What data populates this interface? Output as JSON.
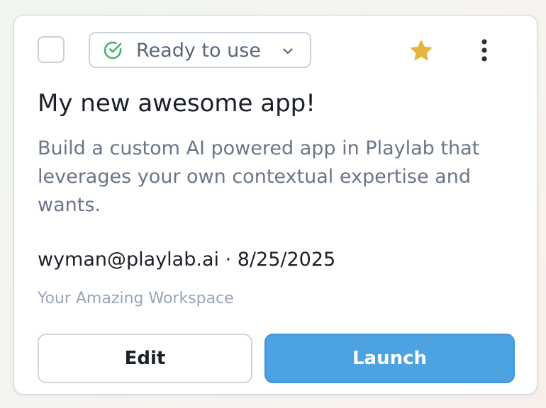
{
  "card": {
    "status": {
      "label": "Ready to use",
      "icon": "check-circle-icon",
      "color": "#4caf6e"
    },
    "favorite": {
      "icon": "star-icon",
      "filled": true,
      "color": "#e8b53c"
    },
    "more_icon": "more-vertical-icon",
    "title": "My new awesome app!",
    "description": "Build a custom AI powered app in Playlab that leverages your own contextual expertise and wants.",
    "meta": "wyman@playlab.ai · 8/25/2025",
    "workspace": "Your Amazing Workspace",
    "buttons": {
      "edit": "Edit",
      "launch": "Launch"
    },
    "accent_color": "#4da3e2"
  }
}
